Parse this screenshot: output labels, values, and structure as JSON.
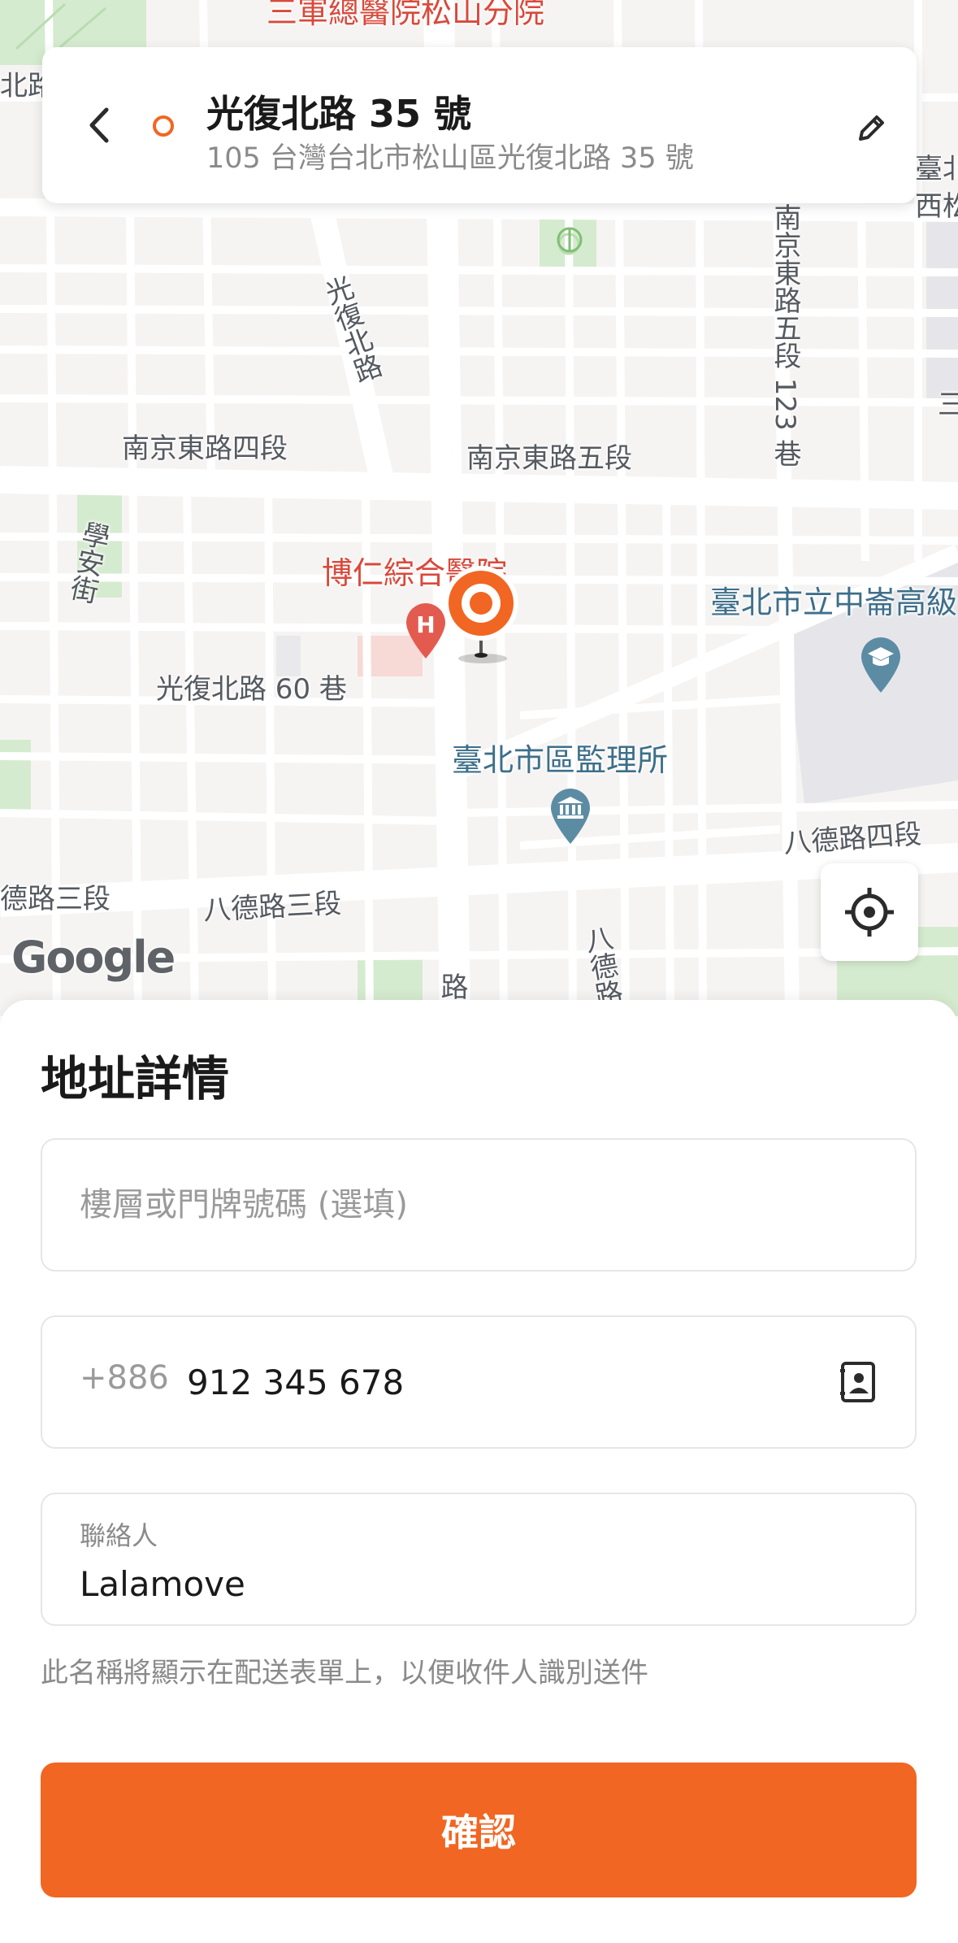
{
  "colors": {
    "accent": "#f16622",
    "map_background": "#f6f4f2",
    "road": "#ffffff",
    "park": "#d5ebcf",
    "poi_red": "#e35b4f",
    "poi_blue": "#5c8ca4"
  },
  "map": {
    "labels": {
      "sanjun": "三軍總醫院松山分院",
      "guangfu_north_rd": "光復北路",
      "nanjing_4": "南京東路四段",
      "nanjing_5": "南京東路五段",
      "nanjing_5_lane123": "南京東路五段 123 巷",
      "xuean_st": "學安街",
      "boren": "博仁綜合醫院",
      "guangfu_lane60": "光復北路 60 巷",
      "zhonglun_high": "臺北市立中崙高級",
      "motor_office": "臺北市區監理所",
      "bade_4": "八德路四段",
      "bade_3_left": "德路三段",
      "bade_3": "八德路三段",
      "bade_vertical": "八德路",
      "edge_top_left": "北路",
      "edge_right_1": "臺北",
      "edge_right_2": "西松",
      "edge_right_3": "三",
      "road_bottom": "路"
    },
    "attribution": "Google",
    "icons": {
      "hospital": "hospital-pin-icon",
      "school": "school-pin-icon",
      "government": "government-pin-icon",
      "park": "park-icon",
      "selected_location": "location-pin-icon",
      "my_location": "crosshair-icon"
    }
  },
  "address": {
    "title": "光復北路 35 號",
    "subtitle": "105 台灣台北市松山區光復北路 35 號",
    "back_icon": "chevron-left-icon",
    "edit_icon": "pencil-icon"
  },
  "sheet": {
    "title": "地址詳情",
    "floor_placeholder": "樓層或門牌號碼 (選填)",
    "floor_value": "",
    "phone_prefix": "+886",
    "phone_value": "912 345 678",
    "contact_book_icon": "contact-book-icon",
    "contact_label": "聯絡人",
    "contact_value": "Lalamove",
    "helper_text": "此名稱將顯示在配送表單上，以便收件人識別送件",
    "confirm_label": "確認"
  }
}
